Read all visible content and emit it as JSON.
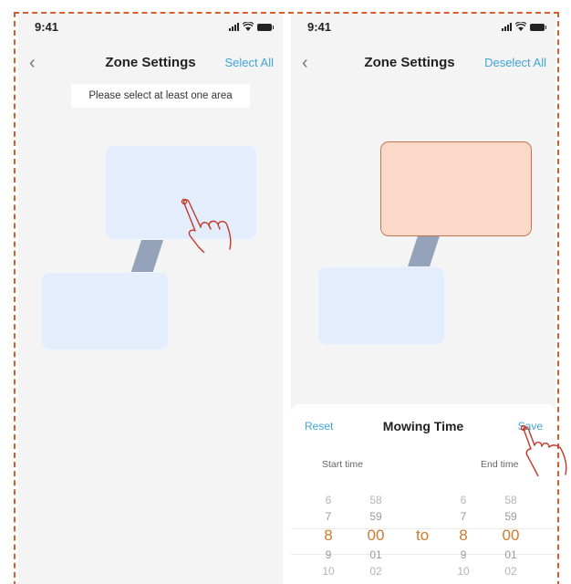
{
  "left_screen": {
    "status": {
      "time": "9:41"
    },
    "nav": {
      "back_icon": "chevron-left-icon",
      "back_glyph": "‹",
      "title": "Zone Settings",
      "action": "Select All"
    },
    "hint": "Please select at least one area",
    "zones": [
      {
        "id": "zone-1",
        "state": "normal"
      },
      {
        "id": "zone-2",
        "state": "normal"
      }
    ]
  },
  "right_screen": {
    "status": {
      "time": "9:41"
    },
    "nav": {
      "back_icon": "chevron-left-icon",
      "back_glyph": "‹",
      "title": "Zone Settings",
      "action": "Deselect All"
    },
    "zones": [
      {
        "id": "zone-1",
        "state": "selected"
      },
      {
        "id": "zone-2",
        "state": "normal"
      }
    ],
    "sheet": {
      "reset": "Reset",
      "title": "Mowing Time",
      "save": "Save",
      "start_label": "Start time",
      "end_label": "End time",
      "to_label": "to",
      "start_hours": [
        "6",
        "7",
        "8",
        "9",
        "10"
      ],
      "start_minutes": [
        "58",
        "59",
        "00",
        "01",
        "02"
      ],
      "end_hours": [
        "6",
        "7",
        "8",
        "9",
        "10"
      ],
      "end_minutes": [
        "58",
        "59",
        "00",
        "01",
        "02"
      ],
      "selected_start": "8:00",
      "selected_end": "8:00"
    }
  },
  "colors": {
    "accent": "#3fa5d8",
    "picker_selected": "#d07a30",
    "zone_normal": "#e3edfb",
    "zone_selected": "#fbd9c8",
    "zone_selected_border": "#c3724f",
    "connector": "#94a3ba",
    "annotation_dashes": "#dd5a2a",
    "annotation_hand": "#c0392b"
  },
  "icons": [
    "signal-icon",
    "wifi-icon",
    "battery-icon",
    "chevron-left-icon",
    "pointing-hand-icon"
  ]
}
